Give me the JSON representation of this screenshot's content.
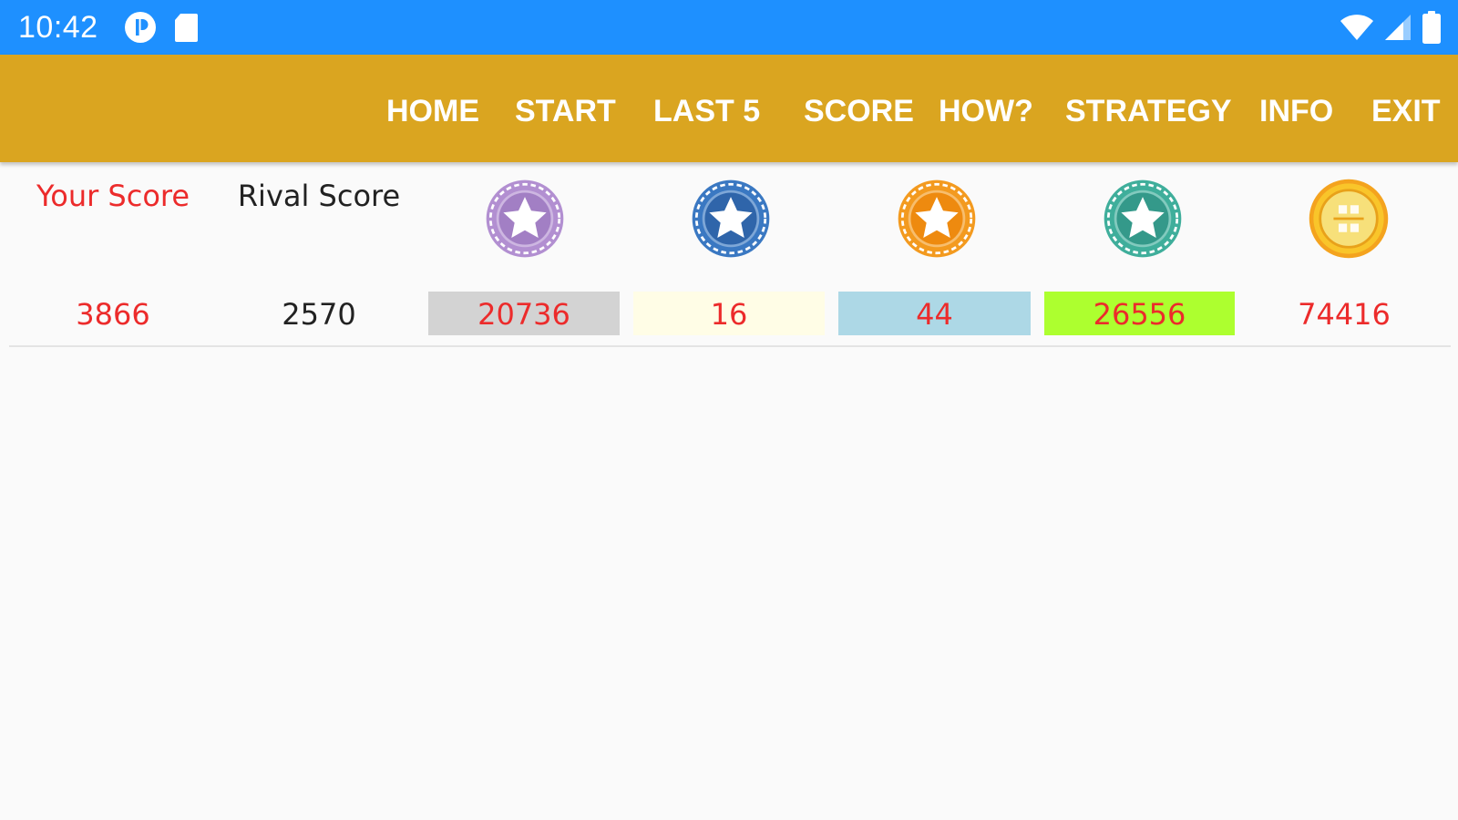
{
  "status_bar": {
    "time": "10:42",
    "icons": [
      "notification-p-icon",
      "sd-card-icon",
      "wifi-icon",
      "cellular-signal-icon",
      "battery-icon"
    ],
    "color": "#1e90ff"
  },
  "action_bar": {
    "color": "#daa520",
    "menu": [
      "HOME",
      "START",
      "LAST 5",
      "SCORE",
      "HOW?",
      "STRATEGY",
      "INFO",
      "EXIT"
    ]
  },
  "scoreboard": {
    "your_score_label": "Your Score",
    "rival_score_label": "Rival Score",
    "your_score": "3866",
    "rival_score": "2570",
    "badges": [
      {
        "icon": "purple-star-badge-icon",
        "color": "#b28fd1",
        "value": "20736",
        "cell_color": "#d3d3d3"
      },
      {
        "icon": "blue-star-badge-icon",
        "color": "#3a78c2",
        "value": "16",
        "cell_color": "#fffde6"
      },
      {
        "icon": "orange-star-badge-icon",
        "color": "#f39a1f",
        "value": "44",
        "cell_color": "#add8e6"
      },
      {
        "icon": "teal-star-badge-icon",
        "color": "#3fae9b",
        "value": "26556",
        "cell_color": "#adff2f"
      },
      {
        "icon": "gold-coin-icon",
        "color": "#f4c01e",
        "value": "74416",
        "cell_color": ""
      }
    ],
    "label_colors": {
      "your": "#ec2b2b",
      "rival": "#222222",
      "values": "#ec2b2b"
    }
  }
}
